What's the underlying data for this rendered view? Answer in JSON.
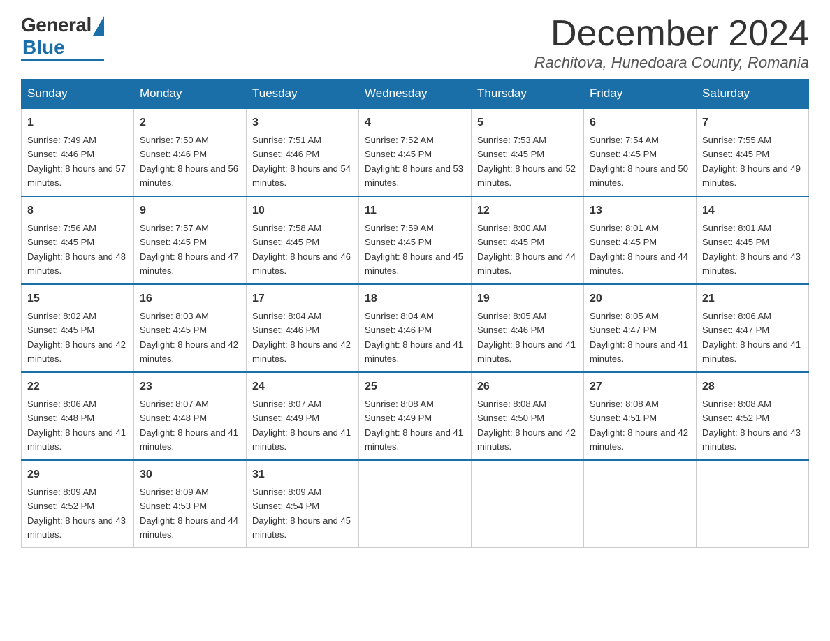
{
  "logo": {
    "general": "General",
    "blue": "Blue"
  },
  "header": {
    "month": "December 2024",
    "location": "Rachitova, Hunedoara County, Romania"
  },
  "weekdays": [
    "Sunday",
    "Monday",
    "Tuesday",
    "Wednesday",
    "Thursday",
    "Friday",
    "Saturday"
  ],
  "weeks": [
    [
      {
        "day": "1",
        "sunrise": "7:49 AM",
        "sunset": "4:46 PM",
        "daylight": "8 hours and 57 minutes."
      },
      {
        "day": "2",
        "sunrise": "7:50 AM",
        "sunset": "4:46 PM",
        "daylight": "8 hours and 56 minutes."
      },
      {
        "day": "3",
        "sunrise": "7:51 AM",
        "sunset": "4:46 PM",
        "daylight": "8 hours and 54 minutes."
      },
      {
        "day": "4",
        "sunrise": "7:52 AM",
        "sunset": "4:45 PM",
        "daylight": "8 hours and 53 minutes."
      },
      {
        "day": "5",
        "sunrise": "7:53 AM",
        "sunset": "4:45 PM",
        "daylight": "8 hours and 52 minutes."
      },
      {
        "day": "6",
        "sunrise": "7:54 AM",
        "sunset": "4:45 PM",
        "daylight": "8 hours and 50 minutes."
      },
      {
        "day": "7",
        "sunrise": "7:55 AM",
        "sunset": "4:45 PM",
        "daylight": "8 hours and 49 minutes."
      }
    ],
    [
      {
        "day": "8",
        "sunrise": "7:56 AM",
        "sunset": "4:45 PM",
        "daylight": "8 hours and 48 minutes."
      },
      {
        "day": "9",
        "sunrise": "7:57 AM",
        "sunset": "4:45 PM",
        "daylight": "8 hours and 47 minutes."
      },
      {
        "day": "10",
        "sunrise": "7:58 AM",
        "sunset": "4:45 PM",
        "daylight": "8 hours and 46 minutes."
      },
      {
        "day": "11",
        "sunrise": "7:59 AM",
        "sunset": "4:45 PM",
        "daylight": "8 hours and 45 minutes."
      },
      {
        "day": "12",
        "sunrise": "8:00 AM",
        "sunset": "4:45 PM",
        "daylight": "8 hours and 44 minutes."
      },
      {
        "day": "13",
        "sunrise": "8:01 AM",
        "sunset": "4:45 PM",
        "daylight": "8 hours and 44 minutes."
      },
      {
        "day": "14",
        "sunrise": "8:01 AM",
        "sunset": "4:45 PM",
        "daylight": "8 hours and 43 minutes."
      }
    ],
    [
      {
        "day": "15",
        "sunrise": "8:02 AM",
        "sunset": "4:45 PM",
        "daylight": "8 hours and 42 minutes."
      },
      {
        "day": "16",
        "sunrise": "8:03 AM",
        "sunset": "4:45 PM",
        "daylight": "8 hours and 42 minutes."
      },
      {
        "day": "17",
        "sunrise": "8:04 AM",
        "sunset": "4:46 PM",
        "daylight": "8 hours and 42 minutes."
      },
      {
        "day": "18",
        "sunrise": "8:04 AM",
        "sunset": "4:46 PM",
        "daylight": "8 hours and 41 minutes."
      },
      {
        "day": "19",
        "sunrise": "8:05 AM",
        "sunset": "4:46 PM",
        "daylight": "8 hours and 41 minutes."
      },
      {
        "day": "20",
        "sunrise": "8:05 AM",
        "sunset": "4:47 PM",
        "daylight": "8 hours and 41 minutes."
      },
      {
        "day": "21",
        "sunrise": "8:06 AM",
        "sunset": "4:47 PM",
        "daylight": "8 hours and 41 minutes."
      }
    ],
    [
      {
        "day": "22",
        "sunrise": "8:06 AM",
        "sunset": "4:48 PM",
        "daylight": "8 hours and 41 minutes."
      },
      {
        "day": "23",
        "sunrise": "8:07 AM",
        "sunset": "4:48 PM",
        "daylight": "8 hours and 41 minutes."
      },
      {
        "day": "24",
        "sunrise": "8:07 AM",
        "sunset": "4:49 PM",
        "daylight": "8 hours and 41 minutes."
      },
      {
        "day": "25",
        "sunrise": "8:08 AM",
        "sunset": "4:49 PM",
        "daylight": "8 hours and 41 minutes."
      },
      {
        "day": "26",
        "sunrise": "8:08 AM",
        "sunset": "4:50 PM",
        "daylight": "8 hours and 42 minutes."
      },
      {
        "day": "27",
        "sunrise": "8:08 AM",
        "sunset": "4:51 PM",
        "daylight": "8 hours and 42 minutes."
      },
      {
        "day": "28",
        "sunrise": "8:08 AM",
        "sunset": "4:52 PM",
        "daylight": "8 hours and 43 minutes."
      }
    ],
    [
      {
        "day": "29",
        "sunrise": "8:09 AM",
        "sunset": "4:52 PM",
        "daylight": "8 hours and 43 minutes."
      },
      {
        "day": "30",
        "sunrise": "8:09 AM",
        "sunset": "4:53 PM",
        "daylight": "8 hours and 44 minutes."
      },
      {
        "day": "31",
        "sunrise": "8:09 AM",
        "sunset": "4:54 PM",
        "daylight": "8 hours and 45 minutes."
      },
      null,
      null,
      null,
      null
    ]
  ]
}
